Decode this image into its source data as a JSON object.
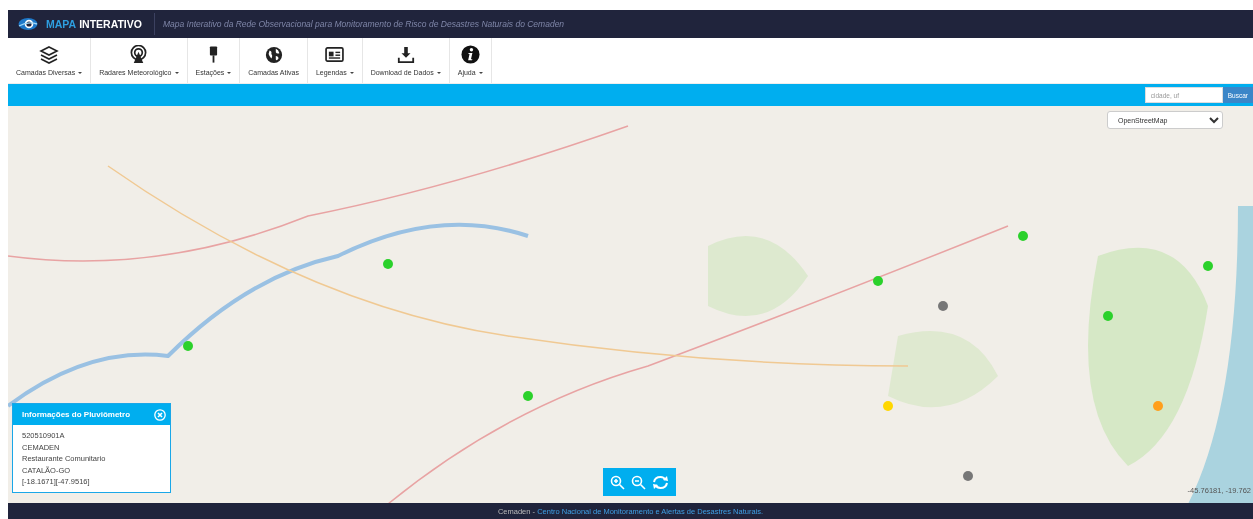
{
  "header": {
    "brand_part_1": "MAPA",
    "brand_part_2": "INTERATIVO",
    "subtitle": "Mapa Interativo da Rede Observacional para Monitoramento de Risco de Desastres Naturais do Cemaden"
  },
  "toolbar": [
    {
      "label": "Camadas Diversas",
      "dropdown": true
    },
    {
      "label": "Radares Meteorológico",
      "dropdown": true
    },
    {
      "label": "Estações",
      "dropdown": true
    },
    {
      "label": "Camadas Ativas",
      "dropdown": false
    },
    {
      "label": "Legendas",
      "dropdown": true
    },
    {
      "label": "Download de Dados",
      "dropdown": true
    },
    {
      "label": "Ajuda",
      "dropdown": true
    }
  ],
  "search": {
    "placeholder": "cidade, uf",
    "button": "Buscar"
  },
  "map": {
    "kind": "picture",
    "layer_select": "OpenStreetMap",
    "coordinates": "-45.76181, -19.762"
  },
  "info_panel": {
    "title": "Informações do Pluviômetro",
    "lines": [
      "520510901A",
      "CEMADEN",
      "Restaurante Comunitario",
      "CATALÃO-GO",
      "[-18.1671][-47.9516]"
    ]
  },
  "footer": {
    "prefix": "Cemaden -",
    "link": "Centro Nacional de Monitoramento e Alertas de Desastres Naturais."
  }
}
